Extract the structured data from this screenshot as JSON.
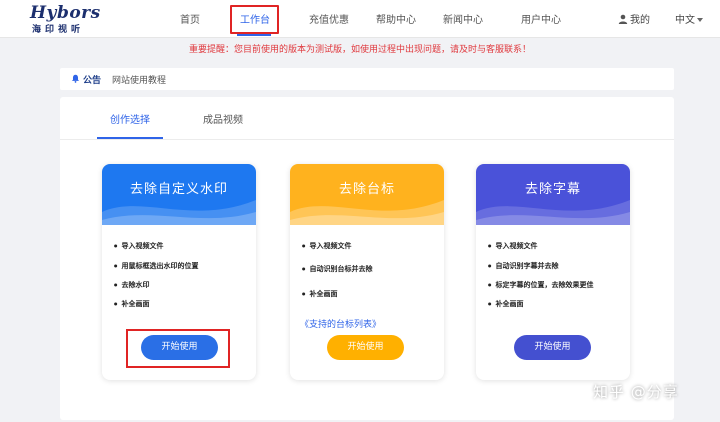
{
  "logo": {
    "main": "Hybors",
    "sub": "海印视听"
  },
  "nav": {
    "items": [
      {
        "label": "首页",
        "active": false
      },
      {
        "label": "工作台",
        "active": true
      },
      {
        "label": "充值优惠",
        "active": false
      },
      {
        "label": "帮助中心",
        "active": false
      },
      {
        "label": "新闻中心",
        "active": false
      },
      {
        "label": "用户中心",
        "active": false
      }
    ],
    "user_label": "我的",
    "language": "中文"
  },
  "notice": "重要提醒：您目前使用的版本为测试版，如使用过程中出现问题，请及时与客服联系！",
  "announcement": {
    "title": "公告",
    "text": "网站使用教程"
  },
  "tabs": [
    {
      "label": "创作选择",
      "active": true
    },
    {
      "label": "成品视频",
      "active": false
    }
  ],
  "cards": [
    {
      "title": "去除自定义水印",
      "features": [
        "导入视频文件",
        "用鼠标框选出水印的位置",
        "去除水印",
        "补全画面"
      ],
      "link": "",
      "button": "开始使用",
      "color": "#1e78f0",
      "button_color": "#2a6fe6"
    },
    {
      "title": "去除台标",
      "features": [
        "导入视频文件",
        "自动识别台标并去除",
        "补全画面"
      ],
      "link": "《支持的台标列表》",
      "button": "开始使用",
      "color": "#ffb21e",
      "button_color": "#ffb000"
    },
    {
      "title": "去除字幕",
      "features": [
        "导入视频文件",
        "自动识别字幕并去除",
        "标定字幕的位置，去除效果更佳",
        "补全画面"
      ],
      "link": "",
      "button": "开始使用",
      "color": "#4a52d9",
      "button_color": "#4450d0"
    }
  ],
  "watermark": "知乎 @分享",
  "colors": {
    "accent": "#2f64e8",
    "notice": "#e0393e",
    "highlight": "#e02424"
  }
}
